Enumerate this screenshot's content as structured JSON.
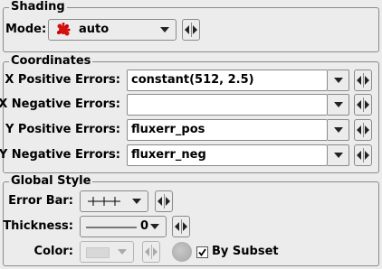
{
  "shading": {
    "legend": "Shading",
    "mode_label": "Mode:",
    "mode_value": "auto",
    "mode_icon": "red-splat-icon"
  },
  "coordinates": {
    "legend": "Coordinates",
    "rows": [
      {
        "label": "X Positive Errors:",
        "value": "constant(512, 2.5)"
      },
      {
        "label": "X Negative Errors:",
        "value": ""
      },
      {
        "label": "Y Positive Errors:",
        "value": "fluxerr_pos"
      },
      {
        "label": "Y Negative Errors:",
        "value": "fluxerr_neg"
      }
    ]
  },
  "global_style": {
    "legend": "Global Style",
    "errorbar_label": "Error Bar:",
    "errorbar_icon": "error-bar-capped-icon",
    "thickness_label": "Thickness:",
    "thickness_value": "0",
    "color_label": "Color:",
    "by_subset_label": "By Subset",
    "by_subset_checked": true
  }
}
